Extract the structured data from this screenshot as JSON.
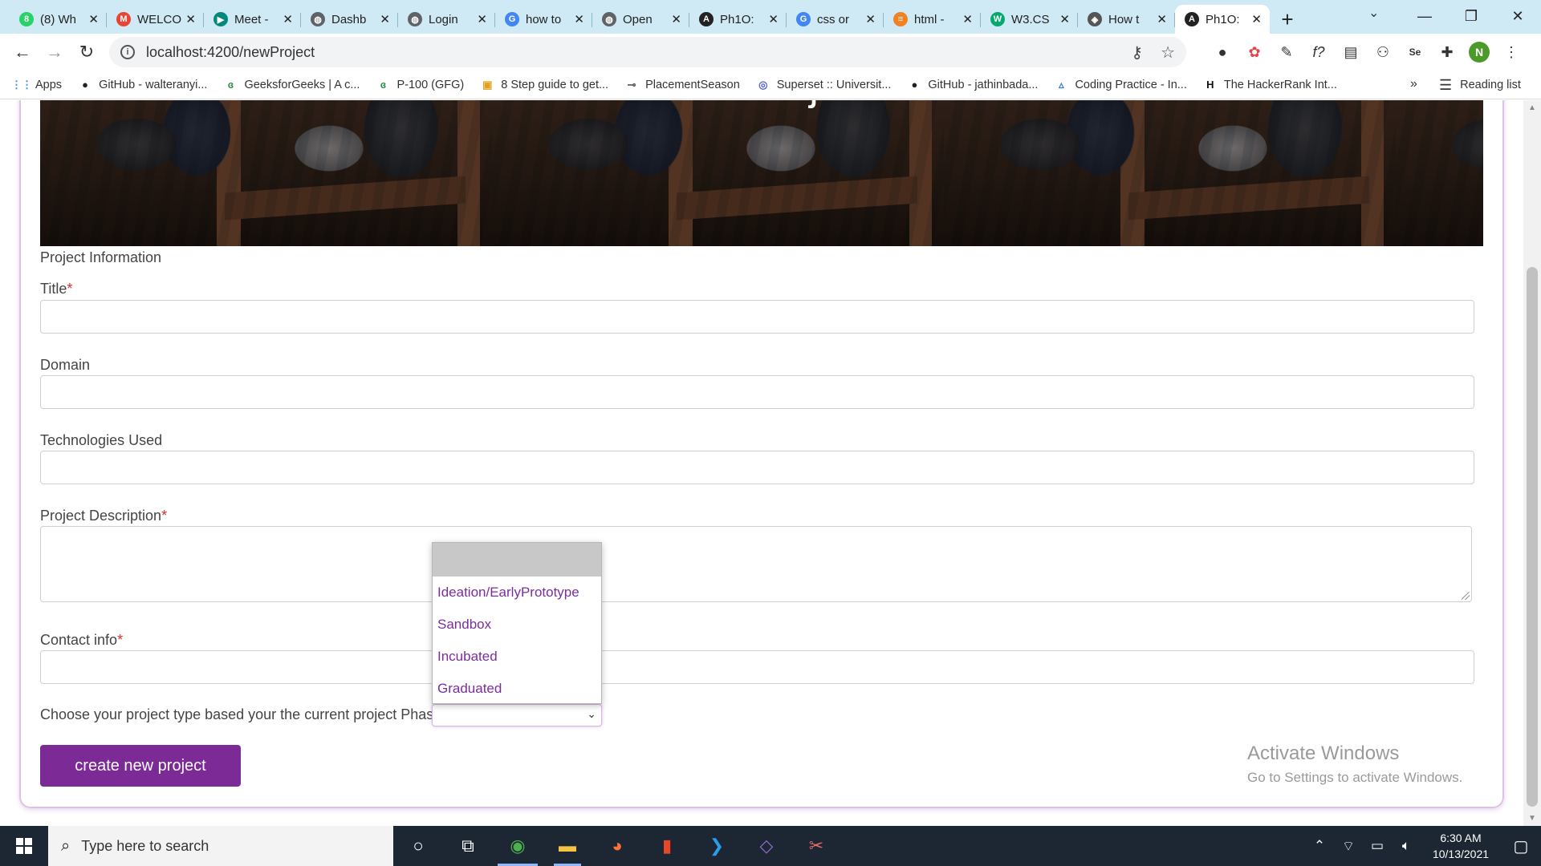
{
  "browser": {
    "tabs": [
      {
        "title": "(8) Wh",
        "favicon": "whatsapp-icon",
        "color": "#25d366",
        "glyph": "8"
      },
      {
        "title": "WELCO",
        "favicon": "gmail-icon",
        "color": "#ea4335",
        "glyph": "M"
      },
      {
        "title": "Meet -",
        "favicon": "meet-icon",
        "color": "#00897b",
        "glyph": "▶"
      },
      {
        "title": "Dashb",
        "favicon": "globe-icon",
        "color": "#5f6368",
        "glyph": "◍"
      },
      {
        "title": "Login",
        "favicon": "globe-icon",
        "color": "#5f6368",
        "glyph": "◍"
      },
      {
        "title": "how to",
        "favicon": "google-icon",
        "color": "#4285f4",
        "glyph": "G"
      },
      {
        "title": "Open",
        "favicon": "globe-icon",
        "color": "#5f6368",
        "glyph": "◍"
      },
      {
        "title": "Ph1O:",
        "favicon": "angular-icon",
        "color": "#222222",
        "glyph": "A"
      },
      {
        "title": "css or",
        "favicon": "google-icon",
        "color": "#4285f4",
        "glyph": "G"
      },
      {
        "title": "html -",
        "favicon": "stackoverflow-icon",
        "color": "#f48024",
        "glyph": "≡"
      },
      {
        "title": "W3.CS",
        "favicon": "w3schools-icon",
        "color": "#04aa6d",
        "glyph": "W"
      },
      {
        "title": "How t",
        "favicon": "diamond-icon",
        "color": "#555555",
        "glyph": "◈"
      },
      {
        "title": "Ph1O:",
        "favicon": "angular-icon",
        "color": "#222222",
        "glyph": "A",
        "active": true
      }
    ],
    "url": "localhost:4200/newProject",
    "profile_initial": "N",
    "bookmarks": [
      {
        "label": "Apps",
        "icon": "apps-grid-icon",
        "glyph": "⋮⋮",
        "color": "#4285f4"
      },
      {
        "label": "GitHub - walteranyi...",
        "icon": "github-icon",
        "glyph": "●",
        "color": "#222"
      },
      {
        "label": "GeeksforGeeks | A c...",
        "icon": "gfg-icon",
        "glyph": "ɞ",
        "color": "#2f8d46"
      },
      {
        "label": "P-100 (GFG)",
        "icon": "gfg-icon",
        "glyph": "ɞ",
        "color": "#2f8d46"
      },
      {
        "label": "8 Step guide to get...",
        "icon": "guide-icon",
        "glyph": "▣",
        "color": "#e0a020"
      },
      {
        "label": "PlacementSeason",
        "icon": "placement-icon",
        "glyph": "⊸",
        "color": "#555"
      },
      {
        "label": "Superset :: Universit...",
        "icon": "superset-icon",
        "glyph": "◎",
        "color": "#5563d6"
      },
      {
        "label": "GitHub - jathinbada...",
        "icon": "github-icon",
        "glyph": "●",
        "color": "#222"
      },
      {
        "label": "Coding Practice - In...",
        "icon": "coding-icon",
        "glyph": "▵",
        "color": "#3a7bd5"
      },
      {
        "label": "The HackerRank Int...",
        "icon": "hackerrank-icon",
        "glyph": "H",
        "color": "#111"
      }
    ],
    "more": "»",
    "reading_list": "Reading list"
  },
  "page": {
    "hero_title": "New Project",
    "section_label": "Project Information",
    "fields": {
      "title": "Title",
      "domain": "Domain",
      "technologies": "Technologies Used",
      "description": "Project Description",
      "contact": "Contact info"
    },
    "required_mark": "*",
    "phase_label": "Choose your project type based your the current project Phase",
    "phase_options": [
      "Ideation/EarlyPrototype",
      "Sandbox",
      "Incubated",
      "Graduated"
    ],
    "create_button": "create new project",
    "watermark": {
      "line1": "Activate Windows",
      "line2": "Go to Settings to activate Windows."
    }
  },
  "taskbar": {
    "search_placeholder": "Type here to search",
    "time": "6:30 AM",
    "date": "10/13/2021"
  },
  "colors": {
    "accent": "#7b2a96",
    "option_text": "#7b2d9c",
    "tabstrip": "#cfe9f5",
    "taskbar": "#1c2733"
  }
}
